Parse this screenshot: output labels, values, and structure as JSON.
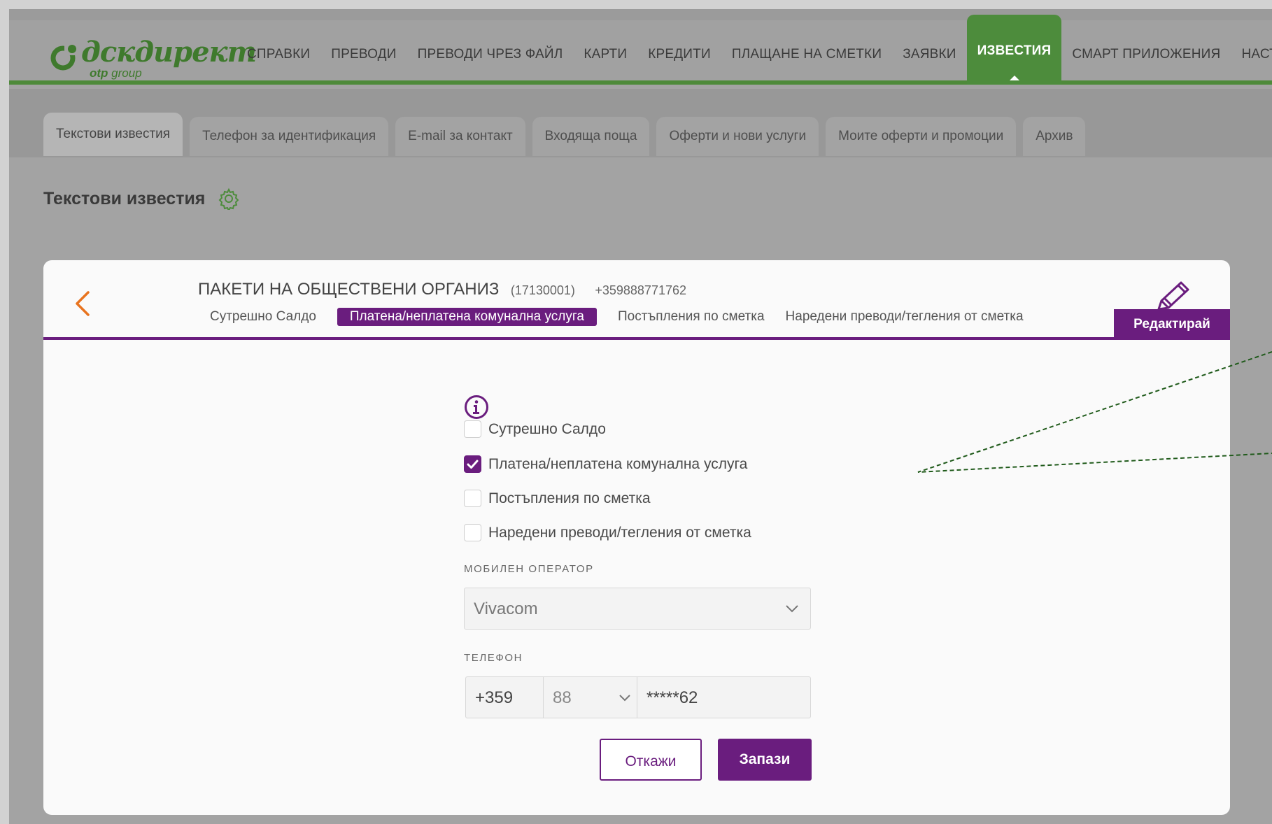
{
  "brand": {
    "logo_main": "дскдирект",
    "logo_sub_bold": "otp",
    "logo_sub": "group",
    "accent_green": "#4d8c3c",
    "accent_purple": "#6a1d7e"
  },
  "nav": {
    "items": [
      {
        "label": "СПРАВКИ"
      },
      {
        "label": "ПРЕВОДИ"
      },
      {
        "label": "ПРЕВОДИ ЧРЕЗ ФАЙЛ"
      },
      {
        "label": "КАРТИ"
      },
      {
        "label": "КРЕДИТИ"
      },
      {
        "label": "ПЛАЩАНЕ НА СМЕТКИ"
      },
      {
        "label": "ЗАЯВКИ"
      },
      {
        "label": "ИЗВЕСТИЯ"
      },
      {
        "label": "СМАРТ ПРИЛОЖЕНИЯ"
      },
      {
        "label": "НАСТРОЙКИ"
      }
    ],
    "active": "ИЗВЕСТИЯ"
  },
  "subtabs": {
    "items": [
      {
        "label": "Текстови известия"
      },
      {
        "label": "Телефон за идентификация"
      },
      {
        "label": "E-mail за контакт"
      },
      {
        "label": "Входяща поща"
      },
      {
        "label": "Оферти и нови услуги"
      },
      {
        "label": "Моите оферти и промоции"
      },
      {
        "label": "Архив"
      }
    ],
    "active": "Текстови известия"
  },
  "page": {
    "title": "Текстови известия",
    "settings_icon": "gear-icon"
  },
  "package": {
    "name": "ПАКЕТИ НА ОБЩЕСТВЕНИ ОРГАНИЗ",
    "code": "(17130001)",
    "phone": "+359888771762",
    "tags": [
      {
        "label": "Сутрешно Салдо",
        "active": false
      },
      {
        "label": "Платена/неплатена комунална услуга",
        "active": true
      },
      {
        "label": "Постъпления по сметка",
        "active": false
      },
      {
        "label": "Наредени преводи/тегления от сметка",
        "active": false
      }
    ],
    "edit_label": "Редактирай"
  },
  "form": {
    "options": [
      {
        "label": "Сутрешно Салдо",
        "checked": false
      },
      {
        "label": "Платена/неплатена комунална услуга",
        "checked": true
      },
      {
        "label": "Постъпления по сметка",
        "checked": false
      },
      {
        "label": "Наредени преводи/тегления от сметка",
        "checked": false
      }
    ],
    "operator_label": "МОБИЛЕН ОПЕРАТОР",
    "operator_value": "Vivacom",
    "phone_label": "ТЕЛЕФОН",
    "phone_country": "+359",
    "phone_operator_code": "88",
    "phone_number": "*****62",
    "cancel_label": "Откажи",
    "save_label": "Запази"
  }
}
